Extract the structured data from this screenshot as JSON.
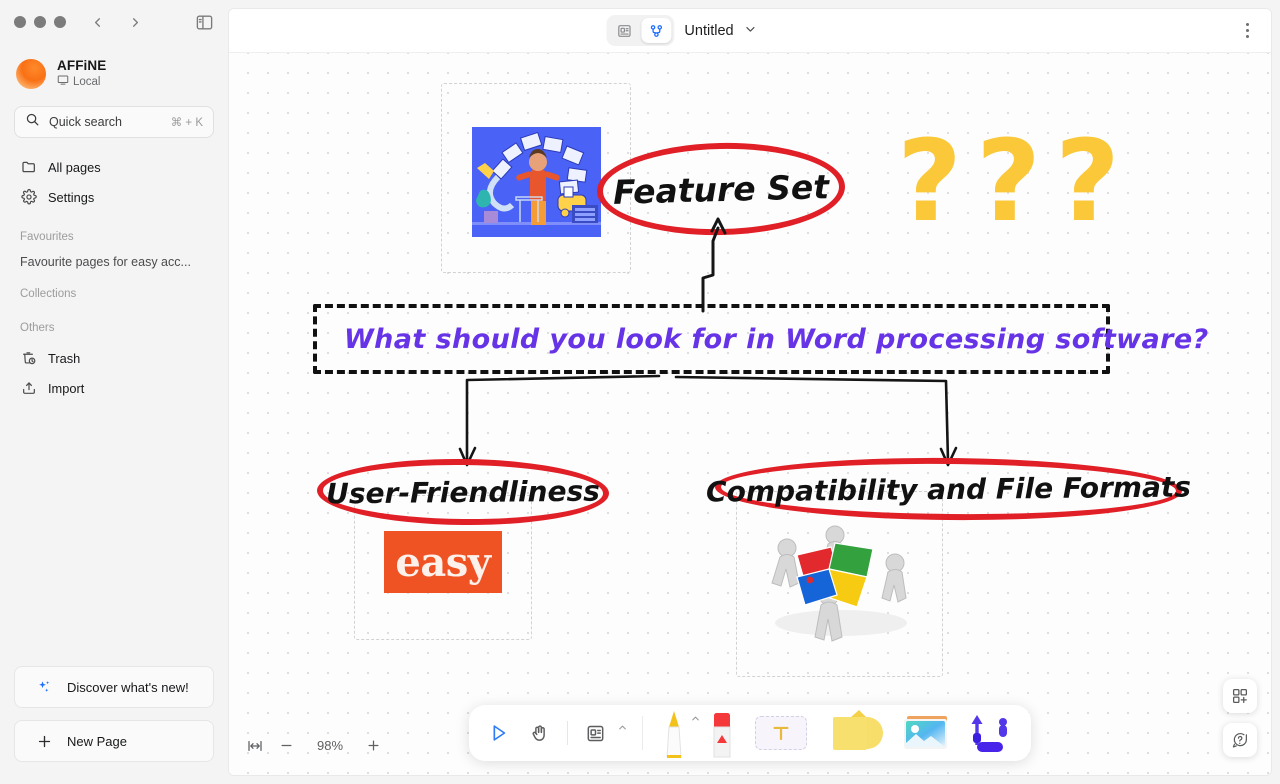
{
  "window": {
    "traffic_lights": [
      "close",
      "minimize",
      "maximize"
    ],
    "back_label": "Back",
    "forward_label": "Forward",
    "panel_toggle_label": "Toggle sidebar"
  },
  "sidebar": {
    "workspace": {
      "name": "AFFiNE",
      "sync_status": "Local"
    },
    "search": {
      "placeholder": "Quick search",
      "shortcut": "⌘ + K"
    },
    "nav": [
      {
        "label": "All pages",
        "icon": "folder-icon"
      },
      {
        "label": "Settings",
        "icon": "gear-icon"
      }
    ],
    "sections": [
      {
        "title": "Favourites",
        "empty_text": "Favourite pages for easy acc..."
      },
      {
        "title": "Collections",
        "empty_text": ""
      },
      {
        "title": "Others",
        "empty_text": ""
      }
    ],
    "others": [
      {
        "label": "Trash",
        "icon": "trash-icon"
      },
      {
        "label": "Import",
        "icon": "import-icon"
      }
    ],
    "bottom_buttons": [
      {
        "label": "Discover what's new!",
        "icon": "sparkles-icon"
      },
      {
        "label": "New Page",
        "icon": "plus-icon"
      }
    ]
  },
  "topbar": {
    "modes": [
      {
        "name": "page-mode",
        "icon": "page-icon",
        "active": false
      },
      {
        "name": "edgeless-mode",
        "icon": "edgeless-icon",
        "active": true
      }
    ],
    "doc_title": "Untitled",
    "title_chevron": "chevron-down-icon",
    "more_menu": "more-vertical-icon"
  },
  "canvas": {
    "background": "#fdfdfd",
    "grid": "dot",
    "nodes": {
      "feature_set": {
        "text": "Feature Set",
        "shape": "ellipse",
        "stroke": "#e01f26"
      },
      "question_box": {
        "text": "What should you look for in Word processing software?",
        "shape": "dashed-rect",
        "text_color": "#6633e6",
        "stroke": "#111111"
      },
      "user_friendliness": {
        "text": "User-Friendliness",
        "shape": "ellipse",
        "stroke": "#e01f26"
      },
      "compatibility": {
        "text": "Compatibility and File Formats",
        "shape": "ellipse",
        "stroke": "#e01f26"
      }
    },
    "images": {
      "doc_illustration": {
        "alt": "person juggling documents illustration",
        "bg": "#4a62f5"
      },
      "question_marks": {
        "alt": "three question marks",
        "glyphs": [
          "?",
          "?",
          "?"
        ],
        "color": "#fbc83a"
      },
      "easy_badge": {
        "alt": "easy logo",
        "text": "easy",
        "bg": "#f05323"
      },
      "puzzle_team": {
        "alt": "figures assembling jigsaw puzzle pieces"
      }
    }
  },
  "dock": {
    "tools": [
      {
        "name": "select-tool",
        "icon": "cursor-icon",
        "active": true
      },
      {
        "name": "hand-tool",
        "icon": "hand-icon",
        "active": false
      },
      {
        "name": "note-tool",
        "icon": "note-icon",
        "active": false,
        "has_caret": true
      },
      {
        "name": "pen-tool",
        "icon": "pen-icon",
        "active": false,
        "has_caret": true
      },
      {
        "name": "eraser-tool",
        "icon": "eraser-icon",
        "active": false
      },
      {
        "name": "text-tool",
        "icon": "text-icon",
        "active": false
      },
      {
        "name": "shape-tool",
        "icon": "shape-icon",
        "active": false
      },
      {
        "name": "image-tool",
        "icon": "image-icon",
        "active": false
      },
      {
        "name": "connector-tool",
        "icon": "connector-icon",
        "active": false
      }
    ]
  },
  "zoom": {
    "fit_label": "Fit to screen",
    "minus_label": "Zoom out",
    "level": "98%",
    "plus_label": "Zoom in"
  },
  "right_tools": [
    {
      "name": "template-button",
      "icon": "grid-plus-icon"
    },
    {
      "name": "help-button",
      "icon": "question-bubble-icon"
    }
  ]
}
